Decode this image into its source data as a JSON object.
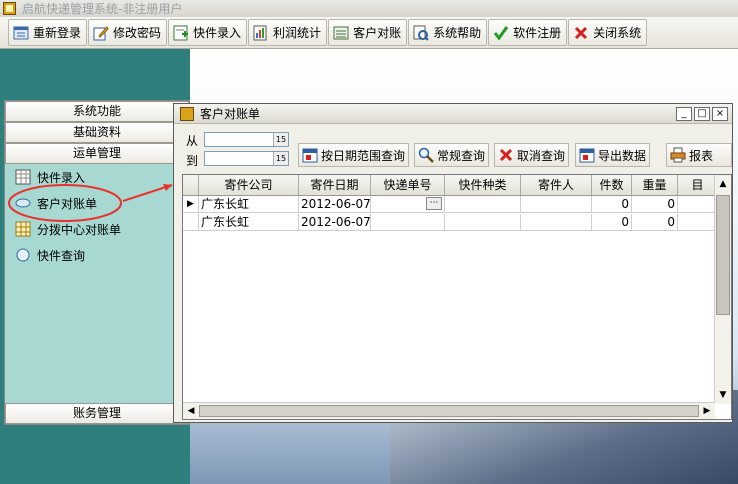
{
  "app": {
    "title": "启航快递管理系统-非注册用户"
  },
  "toolbar": {
    "buttons": [
      {
        "label": "重新登录",
        "icon": "login-icon"
      },
      {
        "label": "修改密码",
        "icon": "edit-password-icon"
      },
      {
        "label": "快件录入",
        "icon": "add-package-icon"
      },
      {
        "label": "利润统计",
        "icon": "stats-icon"
      },
      {
        "label": "客户对账",
        "icon": "ledger-icon"
      },
      {
        "label": "系统帮助",
        "icon": "help-icon"
      },
      {
        "label": "软件注册",
        "icon": "checkmark-icon"
      },
      {
        "label": "关闭系统",
        "icon": "close-x-icon"
      }
    ]
  },
  "sidebar": {
    "categories": [
      "系统功能",
      "基础资料",
      "运单管理"
    ],
    "items": [
      {
        "label": "快件录入",
        "icon": "grid-icon"
      },
      {
        "label": "客户对账单",
        "icon": "disk-icon"
      },
      {
        "label": "分拨中心对账单",
        "icon": "grid-yellow-icon"
      },
      {
        "label": "快件查询",
        "icon": "bubble-icon"
      }
    ],
    "bottom_category": "账务管理"
  },
  "window": {
    "title": "客户对账单",
    "from_label": "从",
    "to_label": "到",
    "from_value": "",
    "to_value": "",
    "calendar_text": "15",
    "buttons": [
      {
        "label": "按日期范围查询",
        "icon": "calendar-icon"
      },
      {
        "label": "常规查询",
        "icon": "magnifier-icon"
      },
      {
        "label": "取消查询",
        "icon": "cancel-x-icon"
      },
      {
        "label": "导出数据",
        "icon": "export-icon"
      },
      {
        "label": "报表",
        "icon": "printer-icon"
      }
    ]
  },
  "grid": {
    "columns": [
      "寄件公司",
      "寄件日期",
      "快递单号",
      "快件种类",
      "寄件人",
      "件数",
      "重量",
      "目"
    ],
    "rows": [
      {
        "company": "广东长虹",
        "date": "2012-06-07",
        "tracking": "",
        "kind": "",
        "sender": "",
        "count": "0",
        "weight": "0",
        "current": true
      },
      {
        "company": "广东长虹",
        "date": "2012-06-07",
        "tracking": "",
        "kind": "",
        "sender": "",
        "count": "0",
        "weight": "0",
        "current": false
      }
    ],
    "ellipsis": "···"
  },
  "colors": {
    "accent_arrow": "#e8322b",
    "desktop_teal": "#2f7f7c",
    "sidebar_panel": "#a8d8d2"
  }
}
